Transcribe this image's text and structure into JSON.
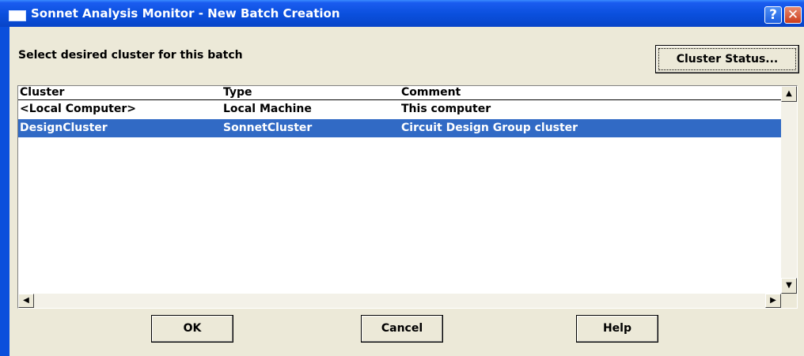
{
  "window": {
    "title": "Sonnet Analysis Monitor - New Batch Creation",
    "help_glyph": "?",
    "close_glyph": "✕",
    "icon": "window-icon"
  },
  "prompt": "Select desired cluster for this batch",
  "buttons": {
    "cluster_status": "Cluster Status...",
    "ok": "OK",
    "cancel": "Cancel",
    "help": "Help"
  },
  "list": {
    "columns": [
      "Cluster",
      "Type",
      "Comment"
    ],
    "rows": [
      {
        "cluster": "<Local Computer>",
        "type": "Local Machine",
        "comment": "This computer",
        "selected": false
      },
      {
        "cluster": "DesignCluster",
        "type": "SonnetCluster",
        "comment": "Circuit Design Group cluster",
        "selected": true
      }
    ]
  },
  "scroll_glyphs": {
    "up": "▲",
    "down": "▼",
    "left": "◀",
    "right": "▶"
  },
  "colors": {
    "selection": "#316ac5",
    "titlebar": "#0a4fdc",
    "dialog_bg": "#ece9d8"
  }
}
